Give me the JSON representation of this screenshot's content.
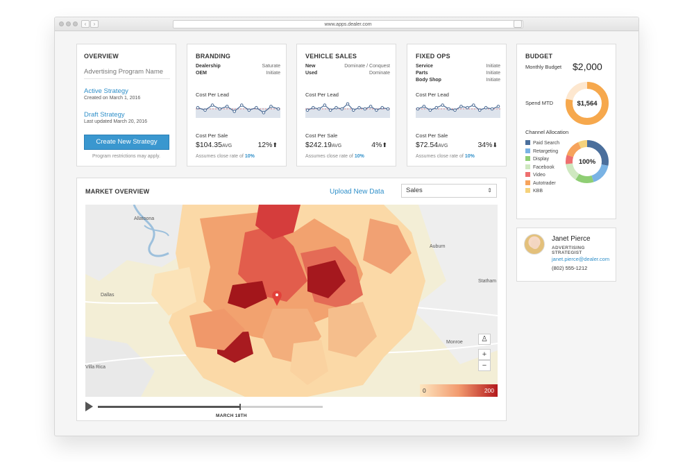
{
  "browser": {
    "url": "www.apps.dealer.com"
  },
  "overview": {
    "title": "OVERVIEW",
    "program_placeholder": "Advertising Program Name",
    "active_strategy": "Active Strategy",
    "active_created": "Created on March 1, 2016",
    "draft_strategy": "Draft Strategy",
    "draft_updated": "Last updated March 20, 2016",
    "create_button": "Create New Strategy",
    "footer": "Program restrictions may apply."
  },
  "cards": [
    {
      "title": "BRANDING",
      "rows": [
        {
          "k": "Dealership",
          "v": "Saturate"
        },
        {
          "k": "OEM",
          "v": "Initiate"
        }
      ],
      "cost_per_lead_label": "Cost Per Lead",
      "cost_per_lead_series": [
        6,
        4,
        8,
        5,
        7,
        3,
        8,
        4,
        6,
        2,
        7,
        5
      ],
      "cost_per_sale_label": "Cost Per Sale",
      "cost_per_sale": "$104.35",
      "avg": "AVG",
      "percent": "12%",
      "trend": "up",
      "assume_prefix": "Assumes close rate of ",
      "close_rate": "10%"
    },
    {
      "title": "VEHICLE SALES",
      "rows": [
        {
          "k": "New",
          "v": "Dominate / Conquest"
        },
        {
          "k": "Used",
          "v": "Dominate"
        }
      ],
      "cost_per_lead_label": "Cost Per Lead",
      "cost_per_lead_series": [
        4,
        6,
        5,
        8,
        4,
        6,
        5,
        9,
        4,
        6,
        5,
        7,
        4,
        6,
        5
      ],
      "cost_per_sale_label": "Cost Per Sale",
      "cost_per_sale": "$242.19",
      "avg": "AVG",
      "percent": "4%",
      "trend": "up",
      "assume_prefix": "Assumes close rate of ",
      "close_rate": "10%"
    },
    {
      "title": "FIXED OPS",
      "rows": [
        {
          "k": "Service",
          "v": "Initiate"
        },
        {
          "k": "Parts",
          "v": "Initiate"
        },
        {
          "k": "Body Shop",
          "v": "Initiate"
        }
      ],
      "cost_per_lead_label": "Cost Per Lead",
      "cost_per_lead_series": [
        5,
        7,
        4,
        6,
        8,
        5,
        4,
        7,
        6,
        8,
        4,
        6,
        5,
        7
      ],
      "cost_per_sale_label": "Cost Per Sale",
      "cost_per_sale": "$72.54",
      "avg": "AVG",
      "percent": "34%",
      "trend": "down",
      "assume_prefix": "Assumes close rate of ",
      "close_rate": "10%"
    }
  ],
  "market": {
    "title": "MARKET OVERVIEW",
    "upload": "Upload New Data",
    "select_value": "Sales",
    "legend_min": "0",
    "legend_max": "200",
    "places": [
      "Allatoona",
      "Dallas",
      "Auburn",
      "Statham",
      "Monroe",
      "Villa Rica"
    ],
    "timeline_label": "MARCH 18TH",
    "timeline_progress": 0.63
  },
  "budget": {
    "title": "BUDGET",
    "monthly_label": "Monthly Budget",
    "monthly_value": "$2,000",
    "spend_label": "Spend MTD",
    "spend_value": "$1,564",
    "spend_fraction": 0.782,
    "channel_label": "Channel Allocation",
    "channel_total": "100%",
    "channels": [
      {
        "name": "Paid Search",
        "color": "#4b6f9c",
        "share": 28
      },
      {
        "name": "Retargeting",
        "color": "#7ab3e4",
        "share": 17
      },
      {
        "name": "Display",
        "color": "#8fce74",
        "share": 14
      },
      {
        "name": "Facebook",
        "color": "#cfe8c0",
        "share": 14
      },
      {
        "name": "Video",
        "color": "#ee6f6f",
        "share": 7
      },
      {
        "name": "Autotrader",
        "color": "#f6a35c",
        "share": 13
      },
      {
        "name": "KBB",
        "color": "#f5d27c",
        "share": 7
      }
    ]
  },
  "contact": {
    "name": "Janet Pierce",
    "role": "ADVERTISING STRATEGIST",
    "email": "janet.pierce@dealer.com",
    "phone": "(802) 555-1212"
  }
}
